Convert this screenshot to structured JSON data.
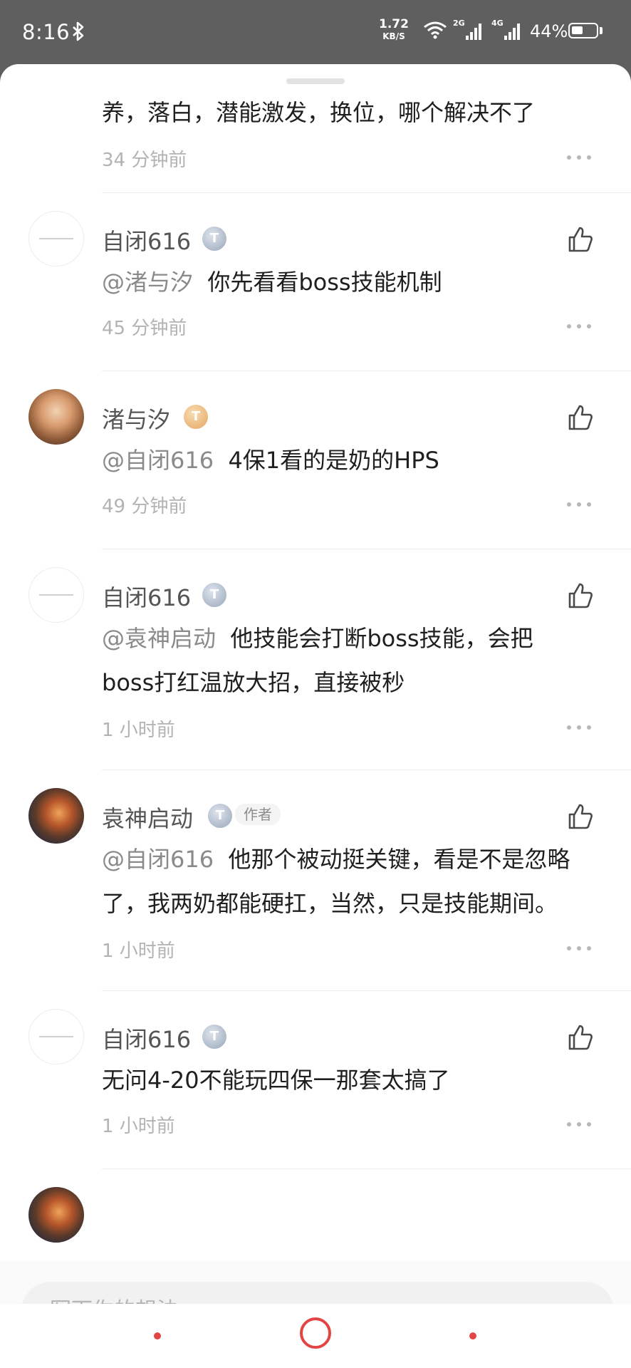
{
  "status_bar": {
    "time": "8:16",
    "net_speed_value": "1.72",
    "net_speed_unit": "KB/S",
    "sim1_label": "2G",
    "sim2_label": "4G",
    "battery": "44%"
  },
  "comments": [
    {
      "text": "养，落白，潜能激发，换位，哪个解决不了",
      "time": "34 分钟前"
    },
    {
      "name": "自闭616",
      "level": "T",
      "mention": "@渚与汐",
      "text": "你先看看boss技能机制",
      "time": "45 分钟前"
    },
    {
      "name": "渚与汐",
      "level": "T",
      "mention": "@自闭616",
      "text": "4保1看的是奶的HPS",
      "time": "49 分钟前"
    },
    {
      "name": "自闭616",
      "level": "T",
      "mention": "@袁神启动",
      "text_line1": "他技能会打断boss技能，会把",
      "text_line2": "boss打红温放大招，直接被秒",
      "time": "1 小时前"
    },
    {
      "name": "袁神启动",
      "level": "T",
      "author_tag": "作者",
      "mention": "@自闭616",
      "text_line1": "他那个被动挺关键，看是不是忽略",
      "text_line2": "了，我两奶都能硬扛，当然，只是技能期间。",
      "time": "1 小时前"
    },
    {
      "name": "自闭616",
      "level": "T",
      "text": "无问4-20不能玩四保一那套太搞了",
      "time": "1 小时前"
    }
  ],
  "input": {
    "placeholder": "写下你的想法..."
  },
  "colors": {
    "accent": "#e34545",
    "status_bar_bg": "#5f5f5f"
  }
}
